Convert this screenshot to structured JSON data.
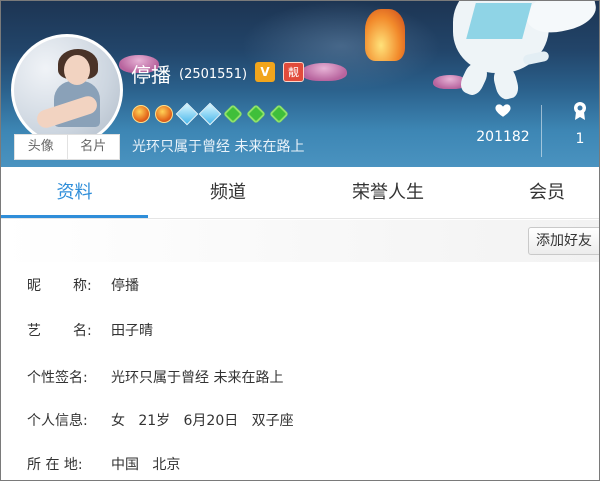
{
  "header": {
    "nickname": "停播",
    "uid": "(2501551)",
    "vip_badge": "V",
    "liang_badge": "靓",
    "medals": [
      "crown-medal",
      "crown-medal",
      "diamond-medal",
      "diamond-medal",
      "leaf-medal",
      "leaf-medal",
      "leaf-medal"
    ],
    "signature": "光环只属于曾经 未来在路上",
    "likes": "201182",
    "awards": "1"
  },
  "avatar": {
    "btn_photo": "头像",
    "btn_card": "名片"
  },
  "tabs": [
    {
      "label": "资料",
      "active": true
    },
    {
      "label": "频道",
      "active": false
    },
    {
      "label": "荣誉人生",
      "active": false
    },
    {
      "label": "会员",
      "active": false
    }
  ],
  "actions": {
    "add_friend": "添加好友"
  },
  "profile": {
    "nickname_label_1": "昵",
    "nickname_label_2": "称:",
    "nickname_value": "停播",
    "stage_label_1": "艺",
    "stage_label_2": "名:",
    "stage_value": "田子晴",
    "signature_label": "个性签名:",
    "signature_value": "光环只属于曾经 未来在路上",
    "info_label": "个人信息:",
    "info_value": "女   21岁   6月20日   双子座",
    "location_label": "所 在 地:",
    "location_value": "中国   北京"
  },
  "colors": {
    "accent": "#2f8ed9",
    "banner_top": "#1d3553",
    "banner_bottom": "#4a93c0"
  }
}
